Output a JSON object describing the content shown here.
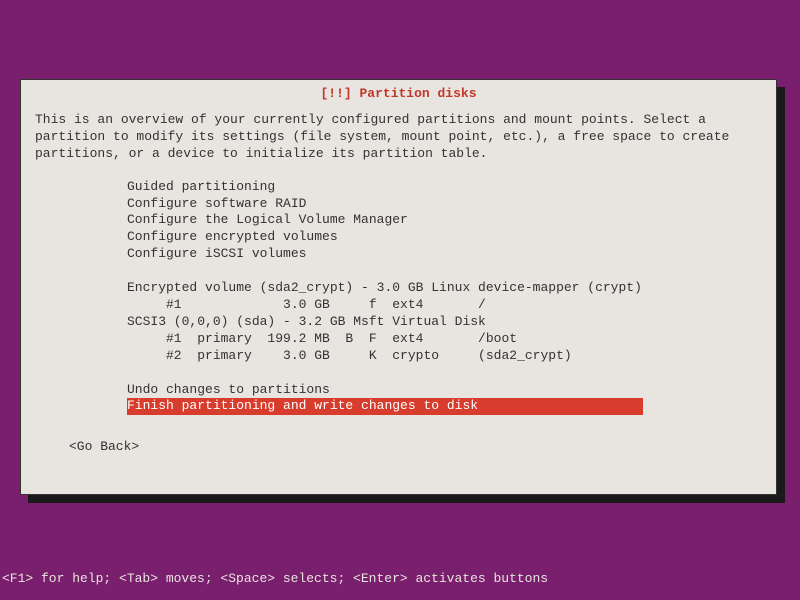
{
  "dialog": {
    "title": "[!!] Partition disks",
    "intro": "This is an overview of your currently configured partitions and mount points. Select a partition to modify its settings (file system, mount point, etc.), a free space to create partitions, or a device to initialize its partition table.",
    "items": [
      "Guided partitioning",
      "Configure software RAID",
      "Configure the Logical Volume Manager",
      "Configure encrypted volumes",
      "Configure iSCSI volumes"
    ],
    "devices": [
      "Encrypted volume (sda2_crypt) - 3.0 GB Linux device-mapper (crypt)",
      "     #1             3.0 GB     f  ext4       /",
      "SCSI3 (0,0,0) (sda) - 3.2 GB Msft Virtual Disk",
      "     #1  primary  199.2 MB  B  F  ext4       /boot",
      "     #2  primary    3.0 GB     K  crypto     (sda2_crypt)"
    ],
    "actions": {
      "undo": "Undo changes to partitions",
      "finish": "Finish partitioning and write changes to disk"
    },
    "go_back": "<Go Back>"
  },
  "footer": "<F1> for help; <Tab> moves; <Space> selects; <Enter> activates buttons"
}
